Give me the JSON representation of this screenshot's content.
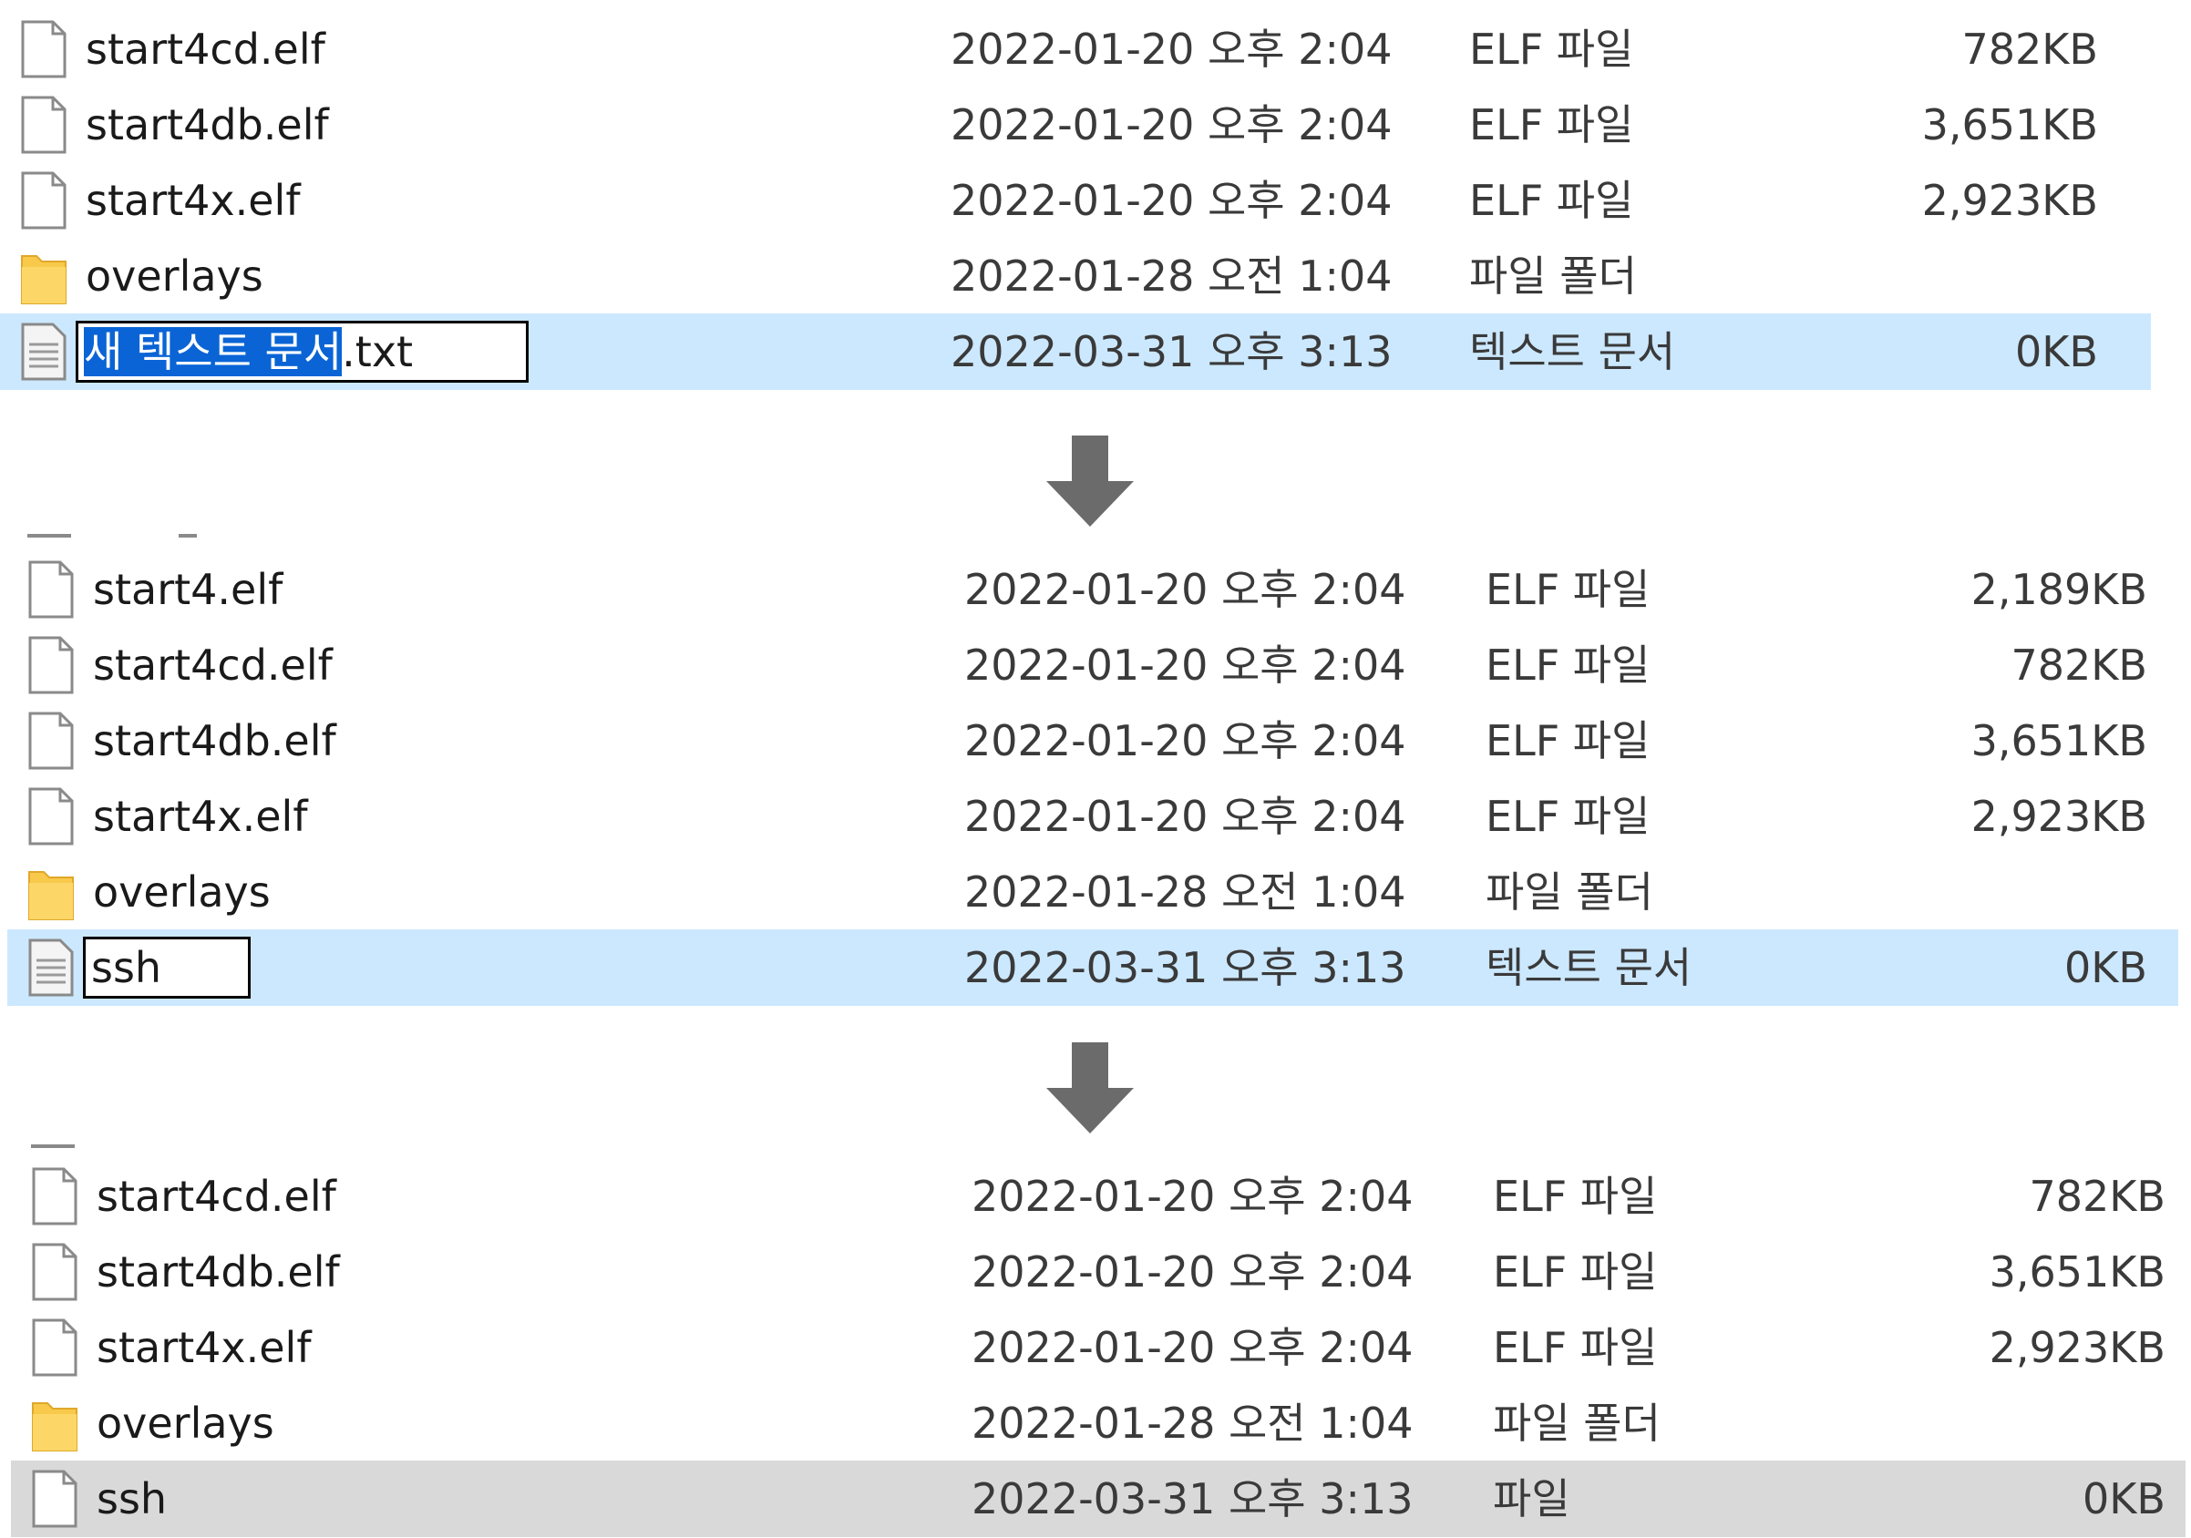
{
  "panels": [
    {
      "rows": [
        {
          "name": "start4cd.elf",
          "date": "2022-01-20 오후 2:04",
          "type": "ELF 파일",
          "size": "782KB",
          "icon": "file-icon"
        },
        {
          "name": "start4db.elf",
          "date": "2022-01-20 오후 2:04",
          "type": "ELF 파일",
          "size": "3,651KB",
          "icon": "file-icon"
        },
        {
          "name": "start4x.elf",
          "date": "2022-01-20 오후 2:04",
          "type": "ELF 파일",
          "size": "2,923KB",
          "icon": "file-icon"
        },
        {
          "name": "overlays",
          "date": "2022-01-28 오전 1:04",
          "type": "파일 폴더",
          "size": "",
          "icon": "folder-icon"
        },
        {
          "name_selected_part": "새 텍스트 문서",
          "name_rest": ".txt",
          "date": "2022-03-31 오후 3:13",
          "type": "텍스트 문서",
          "size": "0KB",
          "icon": "text-file-icon"
        }
      ]
    },
    {
      "rows": [
        {
          "name": "start4.elf",
          "date": "2022-01-20 오후 2:04",
          "type": "ELF 파일",
          "size": "2,189KB",
          "icon": "file-icon"
        },
        {
          "name": "start4cd.elf",
          "date": "2022-01-20 오후 2:04",
          "type": "ELF 파일",
          "size": "782KB",
          "icon": "file-icon"
        },
        {
          "name": "start4db.elf",
          "date": "2022-01-20 오후 2:04",
          "type": "ELF 파일",
          "size": "3,651KB",
          "icon": "file-icon"
        },
        {
          "name": "start4x.elf",
          "date": "2022-01-20 오후 2:04",
          "type": "ELF 파일",
          "size": "2,923KB",
          "icon": "file-icon"
        },
        {
          "name": "overlays",
          "date": "2022-01-28 오전 1:04",
          "type": "파일 폴더",
          "size": "",
          "icon": "folder-icon"
        },
        {
          "name": "ssh",
          "date": "2022-03-31 오후 3:13",
          "type": "텍스트 문서",
          "size": "0KB",
          "icon": "text-file-icon"
        }
      ]
    },
    {
      "rows": [
        {
          "name": "start4cd.elf",
          "date": "2022-01-20 오후 2:04",
          "type": "ELF 파일",
          "size": "782KB",
          "icon": "file-icon"
        },
        {
          "name": "start4db.elf",
          "date": "2022-01-20 오후 2:04",
          "type": "ELF 파일",
          "size": "3,651KB",
          "icon": "file-icon"
        },
        {
          "name": "start4x.elf",
          "date": "2022-01-20 오후 2:04",
          "type": "ELF 파일",
          "size": "2,923KB",
          "icon": "file-icon"
        },
        {
          "name": "overlays",
          "date": "2022-01-28 오전 1:04",
          "type": "파일 폴더",
          "size": "",
          "icon": "folder-icon"
        },
        {
          "name": "ssh",
          "date": "2022-03-31 오후 3:13",
          "type": "파일",
          "size": "0KB",
          "icon": "file-icon"
        }
      ]
    }
  ],
  "arrows": [
    "down-arrow-icon",
    "down-arrow-icon"
  ],
  "colors": {
    "selection_blue": "#cce8ff",
    "selection_gray": "#d9d9d9",
    "rename_highlight": "#0a64d6",
    "arrow": "#6b6b6b",
    "folder": "#f8c94a"
  }
}
